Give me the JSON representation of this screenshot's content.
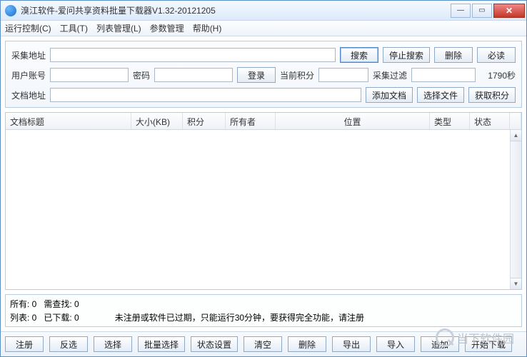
{
  "window": {
    "title": "溴江软件-爱问共享资料批量下载器V1.32-20121205"
  },
  "menu": {
    "run_control": "运行控制(C)",
    "tools": "工具(T)",
    "list_mgmt": "列表管理(L)",
    "param_mgmt": "参数管理",
    "help": "帮助(H)"
  },
  "labels": {
    "collect_url": "采集地址",
    "user_account": "用户账号",
    "password": "密码",
    "current_points": "当前积分",
    "collect_filter": "采集过滤",
    "seconds_suffix": "1790秒",
    "doc_url": "文档地址"
  },
  "buttons": {
    "search": "搜索",
    "stop_search": "停止搜索",
    "delete": "删除",
    "must_read": "必读",
    "login": "登录",
    "add_doc": "添加文档",
    "choose_file": "选择文件",
    "get_points": "获取积分",
    "register": "注册",
    "invert_select": "反选",
    "select": "选择",
    "batch_select": "批量选择",
    "status_settings": "状态设置",
    "clear": "清空",
    "delete2": "删除",
    "export": "导出",
    "import": "导入",
    "append": "追加",
    "start_download": "开始下载"
  },
  "table": {
    "headers": {
      "title": "文档标题",
      "size": "大小(KB)",
      "points": "积分",
      "owner": "所有者",
      "location": "位置",
      "type": "类型",
      "status": "状态"
    }
  },
  "status": {
    "line1_a": "所有: 0",
    "line1_b": "需查找: 0",
    "line2_a": "列表: 0",
    "line2_b": "已下载: 0",
    "notice": "未注册或软件已过期，只能运行30分钟，要获得完全功能，请注册"
  },
  "watermark": "当下软件园"
}
